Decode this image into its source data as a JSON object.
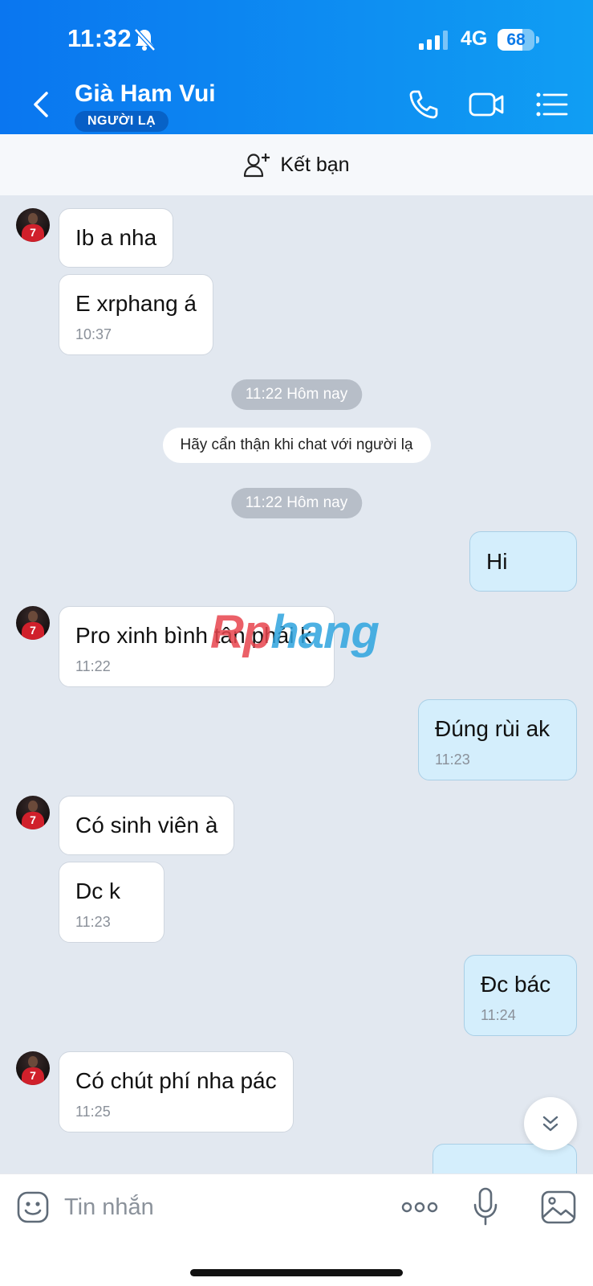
{
  "status_bar": {
    "time": "11:32",
    "network": "4G",
    "battery": "68",
    "battery_level": 0.68
  },
  "header": {
    "title": "Già Ham Vui",
    "badge": "NGƯỜI LẠ"
  },
  "friend_bar": {
    "label": "Kết bạn"
  },
  "messages": {
    "m1": {
      "text": "Ib a nha"
    },
    "m2": {
      "text": "E xrphang á",
      "time": "10:37"
    },
    "sep1": "11:22 Hôm nay",
    "notice": "Hãy cẩn thận khi chat với người lạ",
    "sep2": "11:22 Hôm nay",
    "m3": {
      "text": "Hi"
    },
    "m4": {
      "text": "Pro xinh bình tân phải k",
      "time": "11:22"
    },
    "m5": {
      "text": "Đúng rùi ak",
      "time": "11:23"
    },
    "m6": {
      "text": "Có sinh viên à"
    },
    "m7": {
      "text": "Dc k",
      "time": "11:23"
    },
    "m8": {
      "text": "Đc bác",
      "time": "11:24"
    },
    "m9": {
      "text": "Có chút phí nha pác",
      "time": "11:25"
    }
  },
  "watermark": {
    "part1": "Rp",
    "part2": "hang"
  },
  "composer": {
    "placeholder": "Tin nhắn"
  },
  "colors": {
    "header_start": "#0a76f0",
    "header_end": "#109ef3",
    "outgoing_bubble": "#d4eefc",
    "chat_bg": "#e2e8f0"
  },
  "icons": [
    "bell-slash-icon",
    "signal-icon",
    "back-arrow-icon",
    "phone-icon",
    "video-icon",
    "menu-list-icon",
    "add-user-icon",
    "chevron-double-down-icon",
    "emoji-icon",
    "more-dots-icon",
    "mic-icon",
    "image-icon"
  ]
}
